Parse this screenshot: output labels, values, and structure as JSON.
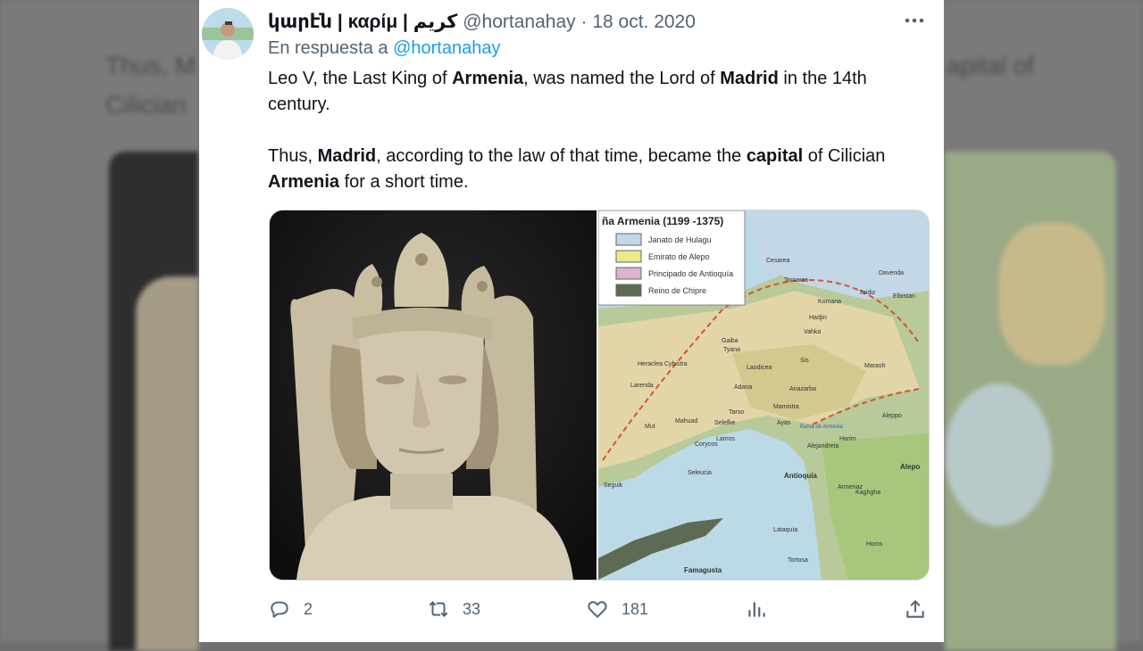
{
  "tweet": {
    "display_name": "կարէն | καρίμ | كريم",
    "handle": "@hortanahay",
    "separator": "·",
    "date": "18 oct. 2020",
    "reply_prefix": "En respuesta a ",
    "reply_handle": "@hortanahay",
    "paragraph1": [
      {
        "t": "Leo V, the Last King of "
      },
      {
        "t": "Armenia",
        "b": true
      },
      {
        "t": ", was named the Lord of "
      },
      {
        "t": "Madrid",
        "b": true
      },
      {
        "t": " in the 14th century."
      }
    ],
    "paragraph2": [
      {
        "t": "Thus, "
      },
      {
        "t": "Madrid",
        "b": true
      },
      {
        "t": ", according to the law of that time, became the "
      },
      {
        "t": "capital",
        "b": true
      },
      {
        "t": " of Cilician "
      },
      {
        "t": "Armenia",
        "b": true
      },
      {
        "t": " for a short time."
      }
    ],
    "map": {
      "title": "ña Armenia (1199 -1375)",
      "legend": [
        {
          "label": "Janato de Hulagu",
          "color": "#c3d7e6"
        },
        {
          "label": "Emirato de Alepo",
          "color": "#ecea8a"
        },
        {
          "label": "Principado de Antioquía",
          "color": "#dcb4cc"
        },
        {
          "label": "Reino de Chipre",
          "color": "#5d6b55"
        }
      ],
      "place_labels": [
        "Cesarea",
        "Tomarza",
        "Davenda",
        "Komana",
        "Tzidiz",
        "Elbistan",
        "Hadjin",
        "Vahka",
        "Sis",
        "Anazarba",
        "Marash",
        "Adana",
        "Tarso",
        "Mamistra",
        "Ayas",
        "Alejandreta",
        "Antioquía",
        "Alepo",
        "Seleucia",
        "Corycos",
        "Lamos",
        "Selefke",
        "Mut",
        "Mahuad",
        "Larenda",
        "Heraclea Cybistra",
        "Tyana",
        "Gaiba",
        "Laodicea",
        "Lataquía",
        "Tortosa",
        "Famagusta",
        "Harim",
        "Seguik",
        "Armenaz",
        "Kaghgha",
        "Homs",
        "Aleppo"
      ],
      "sea_label": "Bahía de Armenia"
    },
    "actions": {
      "replies": "2",
      "retweets": "33",
      "likes": "181"
    }
  },
  "background": {
    "text_line1": "Thus, M",
    "text_line2": "Cilician",
    "text_right": "apital of"
  },
  "colors": {
    "link": "#1d9bf0",
    "text": "#0f1419",
    "muted": "#536471"
  }
}
